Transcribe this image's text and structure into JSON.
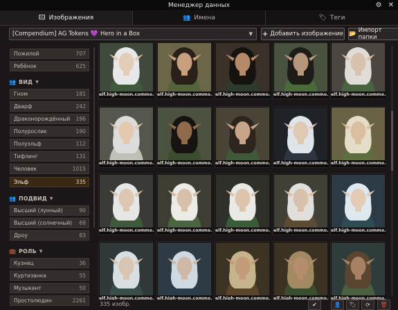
{
  "window": {
    "title": "Менеджер данных"
  },
  "tabs": [
    {
      "label": "Изображения",
      "icon": "image-icon"
    },
    {
      "label": "Имена",
      "icon": "users-icon"
    },
    {
      "label": "Теги",
      "icon": "tag-icon"
    }
  ],
  "toolbar": {
    "compendium": {
      "prefix": "[Compendium] AG Tokens",
      "suffix": "Hero in a Box"
    },
    "add_image_label": "Добавить изображение",
    "import_folder_label": "Импорт папки"
  },
  "sidebar": {
    "age_items": [
      {
        "label": "Пожилой",
        "count": "707"
      },
      {
        "label": "Ребёнок",
        "count": "625"
      }
    ],
    "species": {
      "heading": "ВИД",
      "items": [
        {
          "label": "Гном",
          "count": "181"
        },
        {
          "label": "Дварф",
          "count": "242"
        },
        {
          "label": "Драконорождённый",
          "count": "196"
        },
        {
          "label": "Полурослик",
          "count": "190"
        },
        {
          "label": "Полуэльф",
          "count": "112"
        },
        {
          "label": "Тифлинг",
          "count": "131"
        },
        {
          "label": "Человек",
          "count": "1015"
        },
        {
          "label": "Эльф",
          "count": "335",
          "selected": true
        }
      ]
    },
    "subspecies": {
      "heading": "ПОДВИД",
      "items": [
        {
          "label": "Высший (лунный)",
          "count": "90"
        },
        {
          "label": "Высший (солнечный)",
          "count": "69"
        },
        {
          "label": "Дроу",
          "count": "83"
        }
      ]
    },
    "role": {
      "heading": "РОЛЬ",
      "items": [
        {
          "label": "Кузнец",
          "count": "36"
        },
        {
          "label": "Куртизанка",
          "count": "55"
        },
        {
          "label": "Музыкант",
          "count": "50"
        },
        {
          "label": "Простолюдин",
          "count": "2261"
        }
      ]
    }
  },
  "grid": {
    "caption": "elf.high-moon.commo...",
    "portraits": [
      {
        "bg": "#3f4a3c",
        "hair": "#e8e8ea",
        "skin": "#e4cdb8",
        "cloth": "#3e5a3a"
      },
      {
        "bg": "#6c6648",
        "hair": "#2a201a",
        "skin": "#c9a07e",
        "cloth": "#55633b"
      },
      {
        "bg": "#3a3128",
        "hair": "#161210",
        "skin": "#b58a6a",
        "cloth": "#2e3a2c"
      },
      {
        "bg": "#48523e",
        "hair": "#1d1c18",
        "skin": "#b7977c",
        "cloth": "#4b6a3b"
      },
      {
        "bg": "#4b4740",
        "hair": "#e0ddd8",
        "skin": "#d8c2ae",
        "cloth": "#476640"
      },
      {
        "bg": "#55574e",
        "hair": "#dcdcdc",
        "skin": "#e2c9b0",
        "cloth": "#bfc0b8"
      },
      {
        "bg": "#4b5240",
        "hair": "#171310",
        "skin": "#8f6b4e",
        "cloth": "#3a4d2c"
      },
      {
        "bg": "#4a4436",
        "hair": "#2e261e",
        "skin": "#c8a488",
        "cloth": "#3e5a37"
      },
      {
        "bg": "#1f2328",
        "hair": "#dfe4ea",
        "skin": "#e0c9b4",
        "cloth": "#2d3540"
      },
      {
        "bg": "#6a6245",
        "hair": "#e4ddc8",
        "skin": "#d9bfa0",
        "cloth": "#5e6e3e"
      },
      {
        "bg": "#3a3a36",
        "hair": "#e6e6e6",
        "skin": "#ddc6b2",
        "cloth": "#3f5a3a"
      },
      {
        "bg": "#3e3d33",
        "hair": "#ecebe6",
        "skin": "#d7c0aa",
        "cloth": "#4b6540"
      },
      {
        "bg": "#2f302a",
        "hair": "#e9e9e6",
        "skin": "#ddc4ad",
        "cloth": "#3b5c37"
      },
      {
        "bg": "#404036",
        "hair": "#e1dfdb",
        "skin": "#d8c1aa",
        "cloth": "#5b4b32"
      },
      {
        "bg": "#2c3a45",
        "hair": "#dfe8ef",
        "skin": "#e2ccb6",
        "cloth": "#2f4c55"
      },
      {
        "bg": "#31383a",
        "hair": "#d8dfe3",
        "skin": "#d8c4b2",
        "cloth": "#384c48"
      },
      {
        "bg": "#2e3a44",
        "hair": "#cfd9e2",
        "skin": "#cfb9a6",
        "cloth": "#2a3d48"
      },
      {
        "bg": "#3c3325",
        "hair": "#c5b48a",
        "skin": "#c29c78",
        "cloth": "#5a4528"
      },
      {
        "bg": "#3b3224",
        "hair": "#a18a62",
        "skin": "#b48e6a",
        "cloth": "#3a4d2c"
      },
      {
        "bg": "#2e3c3c",
        "hair": "#5a4630",
        "skin": "#a88062",
        "cloth": "#4a5e40"
      }
    ]
  },
  "footer": {
    "count_text": "335 изобр."
  }
}
